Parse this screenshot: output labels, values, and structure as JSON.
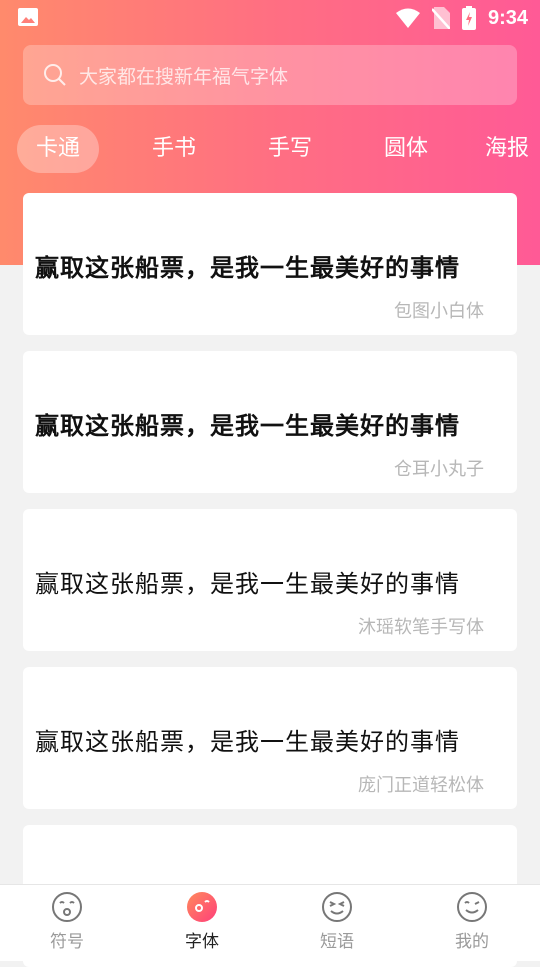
{
  "status": {
    "time": "9:34"
  },
  "search": {
    "placeholder": "大家都在搜新年福气字体"
  },
  "tabs": [
    {
      "label": "卡通"
    },
    {
      "label": "手书"
    },
    {
      "label": "手写"
    },
    {
      "label": "圆体"
    },
    {
      "label": "海报"
    }
  ],
  "fonts": [
    {
      "sample": "赢取这张船票，是我一生最美好的事情",
      "name": "包图小白体"
    },
    {
      "sample": "赢取这张船票，是我一生最美好的事情",
      "name": "仓耳小丸子"
    },
    {
      "sample": "赢取这张船票，是我一生最美好的事情",
      "name": "沐瑶软笔手写体"
    },
    {
      "sample": "赢取这张船票，是我一生最美好的事情",
      "name": "庞门正道轻松体"
    }
  ],
  "nav": [
    {
      "label": "符号",
      "icon": "face-icon"
    },
    {
      "label": "字体",
      "icon": "font-face-icon"
    },
    {
      "label": "短语",
      "icon": "smile-icon"
    },
    {
      "label": "我的",
      "icon": "wink-icon"
    }
  ],
  "colors": {
    "gradient_start": "#ff8a6c",
    "gradient_end": "#ff5a96",
    "accent": "#ff4f7a"
  }
}
